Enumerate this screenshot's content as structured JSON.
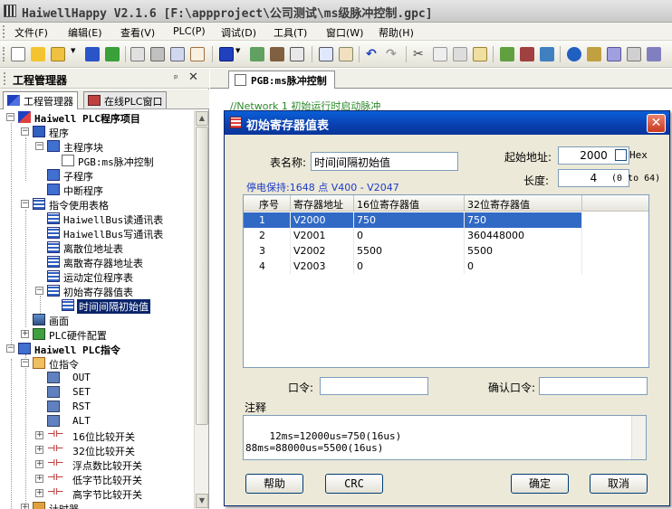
{
  "window": {
    "title": "HaiwellHappy V2.1.6 [F:\\appproject\\公司测试\\ms级脉冲控制.gpc]"
  },
  "menu": [
    "文件(F)",
    "编辑(E)",
    "查看(V)",
    "PLC(P)",
    "调试(D)",
    "工具(T)",
    "窗口(W)",
    "帮助(H)"
  ],
  "project_manager": {
    "title": "工程管理器",
    "tabs": [
      "工程管理器",
      "在线PLC窗口"
    ]
  },
  "tree": {
    "root": "Haiwell PLC程序项目",
    "program": "程序",
    "main_block": "主程序块",
    "pgb": "PGB:ms脉冲控制",
    "sub": "子程序",
    "interrupt": "中断程序",
    "tables": "指令使用表格",
    "bus_read": "HaiwellBus读通讯表",
    "bus_write": "HaiwellBus写通讯表",
    "discrete_bit": "离散位地址表",
    "discrete_reg": "离散寄存器地址表",
    "motion": "运动定位程序表",
    "init_reg": "初始寄存器值表",
    "time_init": "时间间隔初始值",
    "screen": "画面",
    "hw_config": "PLC硬件配置",
    "instructions": "Haiwell PLC指令",
    "bit_instr": "位指令",
    "out": "OUT",
    "set": "SET",
    "rst": "RST",
    "alt": "ALT",
    "cmp16": "16位比较开关",
    "cmp32": "32位比较开关",
    "cmpf": "浮点数比较开关",
    "cmp_low": "低字节比较开关",
    "cmp_high": "高字节比较开关",
    "timer": "计时器"
  },
  "doc_tab": "PGB:ms脉冲控制",
  "editor_comment": "//Network 1  初始运行时启动脉冲",
  "dialog": {
    "title": "初始寄存器值表",
    "table_name_label": "表名称:",
    "table_name_value": "时间间隔初始值",
    "start_addr_label": "起始地址:",
    "start_addr_value": "2000",
    "hex_label": "Hex",
    "length_label": "长度:",
    "length_value": "4",
    "length_range": "(0 to 64)",
    "retention": "停电保持:1648 点 V400 - V2047",
    "columns": [
      "序号",
      "寄存器地址",
      "16位寄存器值",
      "32位寄存器值"
    ],
    "rows": [
      [
        "1",
        "V2000",
        "750",
        "750"
      ],
      [
        "2",
        "V2001",
        "0",
        "360448000"
      ],
      [
        "3",
        "V2002",
        "5500",
        "5500"
      ],
      [
        "4",
        "V2003",
        "0",
        "0"
      ]
    ],
    "password_label": "口令:",
    "confirm_label": "确认口令:",
    "notes_label": "注释",
    "notes": "12ms=12000us=750(16us)\n88ms=88000us=5500(16us)",
    "buttons": {
      "help": "帮助",
      "crc": "CRC",
      "ok": "确定",
      "cancel": "取消"
    }
  }
}
